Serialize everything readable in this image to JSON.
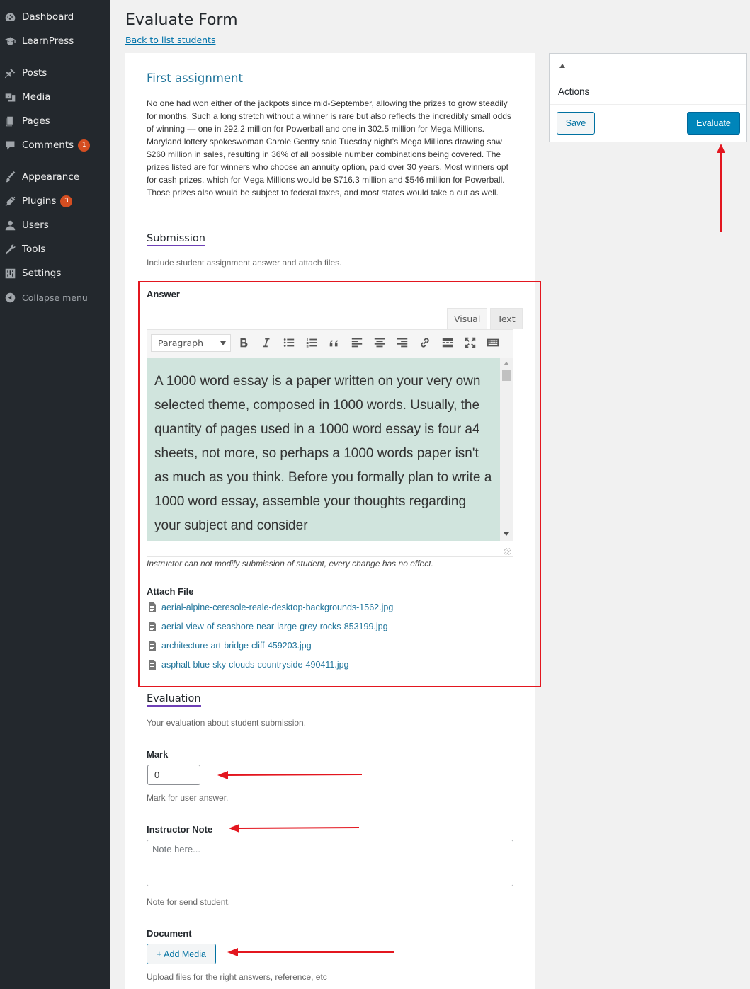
{
  "sidebar": {
    "items": [
      {
        "label": "Dashboard",
        "icon": "dashboard-icon"
      },
      {
        "label": "LearnPress",
        "icon": "learnpress-icon"
      },
      {
        "label": "Posts",
        "icon": "pin-icon"
      },
      {
        "label": "Media",
        "icon": "media-icon"
      },
      {
        "label": "Pages",
        "icon": "pages-icon"
      },
      {
        "label": "Comments",
        "icon": "comment-icon",
        "badge": "1"
      },
      {
        "label": "Appearance",
        "icon": "brush-icon"
      },
      {
        "label": "Plugins",
        "icon": "plugin-icon",
        "badge": "3"
      },
      {
        "label": "Users",
        "icon": "user-icon"
      },
      {
        "label": "Tools",
        "icon": "wrench-icon"
      },
      {
        "label": "Settings",
        "icon": "settings-icon"
      }
    ],
    "collapse_label": "Collapse menu"
  },
  "header": {
    "title": "Evaluate Form",
    "back_link": "Back to list students"
  },
  "assignment": {
    "title": "First assignment",
    "description": "No one had won either of the jackpots since mid-September, allowing the prizes to grow steadily for months. Such a long stretch without a winner is rare but also reflects the incredibly small odds of winning — one in 292.2 million for Powerball and one in 302.5 million for Mega Millions. Maryland lottery spokeswoman Carole Gentry said Tuesday night's Mega Millions drawing saw $260 million in sales, resulting in 36% of all possible number combinations being covered. The prizes listed are for winners who choose an annuity option, paid over 30 years. Most winners opt for cash prizes, which for Mega Millions would be $716.3 million and $546 million for Powerball. Those prizes also would be subject to federal taxes, and most states would take a cut as well."
  },
  "submission": {
    "heading": "Submission",
    "description": "Include student assignment answer and attach files.",
    "answer_label": "Answer",
    "tabs": {
      "visual": "Visual",
      "text": "Text"
    },
    "format_select": "Paragraph",
    "toolbar_icons": [
      "bold-icon",
      "italic-icon",
      "bullet-list-icon",
      "numbered-list-icon",
      "blockquote-icon",
      "align-left-icon",
      "align-center-icon",
      "align-right-icon",
      "link-icon",
      "read-more-icon",
      "fullscreen-icon",
      "toolbar-toggle-icon"
    ],
    "answer_text": "A 1000 word essay is a paper written on your very own selected theme, composed in 1000 words. Usually, the quantity of pages used in a 1000 word essay is four a4 sheets, not more, so perhaps a 1000 words paper isn't as much as you think. Before you formally plan to write a 1000 word essay, assemble your thoughts regarding your subject and consider",
    "editor_note": "Instructor can not modify submission of student, every change has no effect.",
    "attach_label": "Attach File",
    "files": [
      "aerial-alpine-ceresole-reale-desktop-backgrounds-1562.jpg",
      "aerial-view-of-seashore-near-large-grey-rocks-853199.jpg",
      "architecture-art-bridge-cliff-459203.jpg",
      "asphalt-blue-sky-clouds-countryside-490411.jpg"
    ]
  },
  "evaluation": {
    "heading": "Evaluation",
    "description": "Your evaluation about student submission.",
    "mark_label": "Mark",
    "mark_value": "0",
    "mark_desc": "Mark for user answer.",
    "note_label": "Instructor Note",
    "note_placeholder": "Note here...",
    "note_desc": "Note for send student.",
    "document_label": "Document",
    "add_media": "+ Add Media",
    "document_desc": "Upload files for the right answers, reference, etc"
  },
  "actions": {
    "title": "Actions",
    "save": "Save",
    "evaluate": "Evaluate"
  },
  "colors": {
    "sidebar_bg": "#23282d",
    "accent": "#0085ba",
    "highlight": "#e3161f",
    "editor_bg": "#d0e4dd"
  }
}
